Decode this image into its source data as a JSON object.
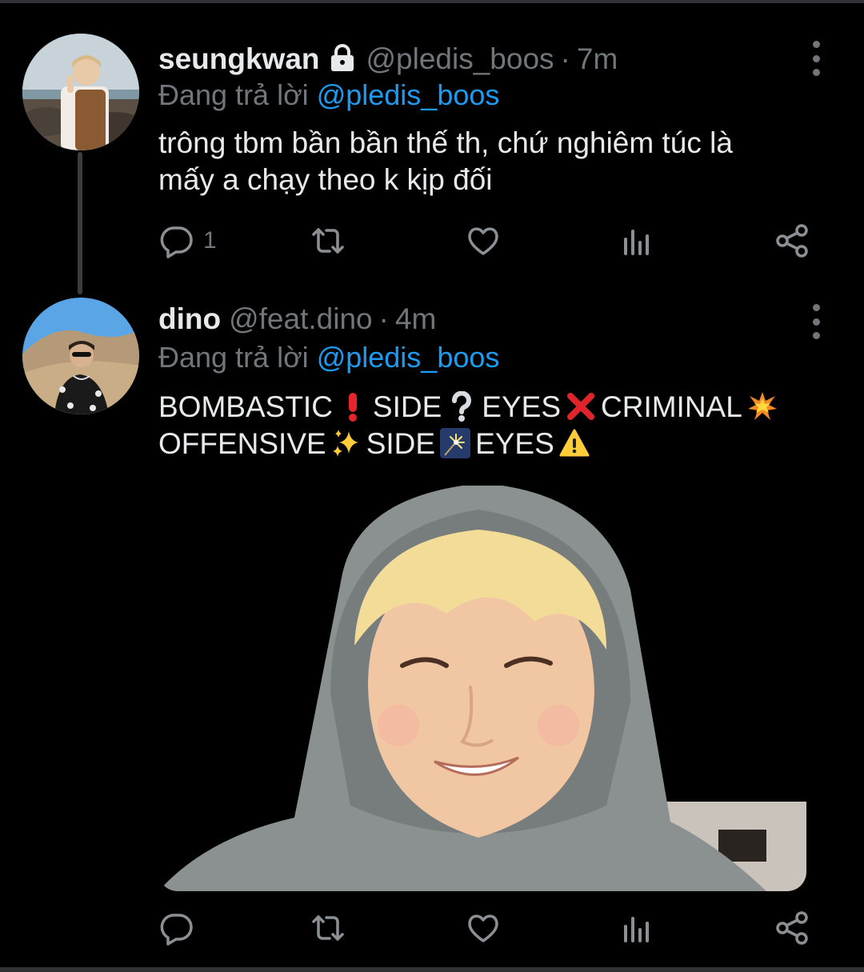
{
  "tweets": [
    {
      "name": "seungkwan",
      "protected": true,
      "handle": "@pledis_boos",
      "separator": "·",
      "time": "7m",
      "reply_prefix": "Đang trả lời",
      "reply_to": "@pledis_boos",
      "body_lines": [
        "trông tbm bần bần thế th, chứ nghiêm túc là",
        "mấy a chạy theo k kịp đối"
      ],
      "reply_count": "1",
      "retweet_count": "",
      "like_count": ""
    },
    {
      "name": "dino",
      "protected": false,
      "handle": "@feat.dino",
      "separator": "·",
      "time": "4m",
      "reply_prefix": "Đang trả lời",
      "reply_to": "@pledis_boos",
      "body_line1": [
        "BOMBASTIC",
        "SIDE",
        "EYES",
        "CRIMINAL"
      ],
      "body_line2": [
        "OFFENSIVE",
        "SIDE",
        "EYES"
      ],
      "emoji_line1": [
        "red-exclamation",
        "white-question",
        "cross-mark",
        "collision"
      ],
      "emoji_line2": [
        "sparkles",
        "sparkler",
        "warning"
      ],
      "reply_count": "",
      "retweet_count": "",
      "like_count": ""
    }
  ],
  "icons": [
    "reply-icon",
    "retweet-icon",
    "like-icon",
    "analytics-icon",
    "share-icon",
    "more-icon",
    "lock-icon"
  ],
  "colors": {
    "background": "#000000",
    "text": "#e7e9ea",
    "muted": "#71767b",
    "link": "#1d9bf0"
  }
}
